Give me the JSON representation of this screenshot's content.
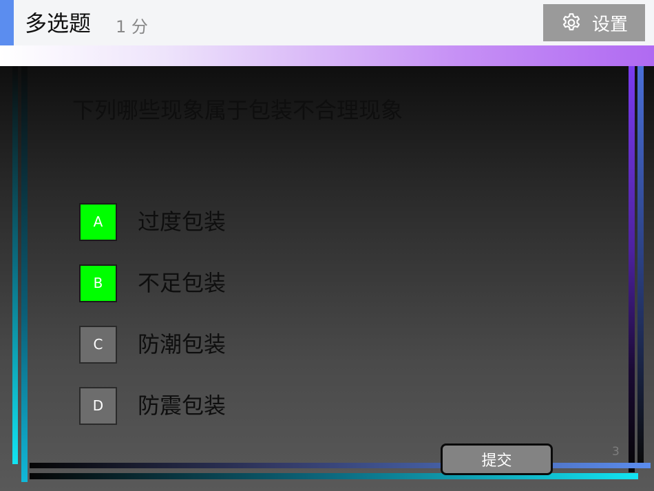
{
  "header": {
    "title": "多选题",
    "score": "1 分",
    "settings_label": "设置"
  },
  "question": {
    "text": "下列哪些现象属于包装不合理现象",
    "options": [
      {
        "letter": "A",
        "text": "过度包装",
        "selected": true
      },
      {
        "letter": "B",
        "text": "不足包装",
        "selected": true
      },
      {
        "letter": "C",
        "text": "防潮包装",
        "selected": false
      },
      {
        "letter": "D",
        "text": "防震包装",
        "selected": false
      }
    ]
  },
  "footer": {
    "submit_label": "提交",
    "page_number": "3"
  },
  "colors": {
    "selected": "#00ff00",
    "unselected": "#6d6d6d",
    "accent": "#5b8def"
  },
  "icons": {
    "settings": "gear-icon"
  }
}
